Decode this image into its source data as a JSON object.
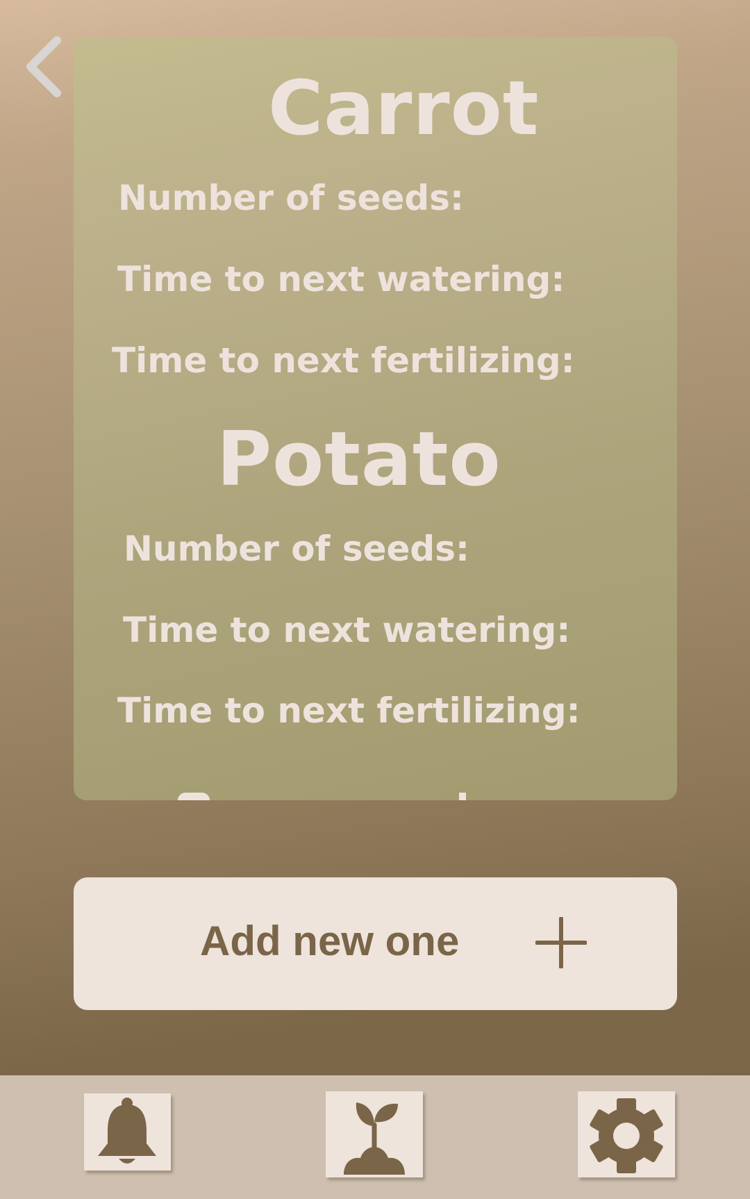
{
  "header": {
    "back_icon": "chevron-left-icon"
  },
  "plants": [
    {
      "name": "Carrot",
      "seeds_label": "Number of seeds:",
      "watering_label": "Time to next watering:",
      "fertilizing_label": "Time to next fertilizing:"
    },
    {
      "name": "Potato",
      "seeds_label": "Number of seeds:",
      "watering_label": "Time to next watering:",
      "fertilizing_label": "Time to next fertilizing:"
    }
  ],
  "add_button": {
    "label": "Add new one",
    "icon": "plus-icon"
  },
  "bottom_nav": {
    "items": [
      {
        "icon": "bell-icon"
      },
      {
        "icon": "sprout-icon"
      },
      {
        "icon": "gear-icon"
      }
    ]
  },
  "colors": {
    "card_bg": "#b8ae84",
    "text_light": "#eee3dc",
    "button_bg": "#efe4dc",
    "button_text": "#7a6548",
    "nav_bg": "#cebfb0"
  }
}
